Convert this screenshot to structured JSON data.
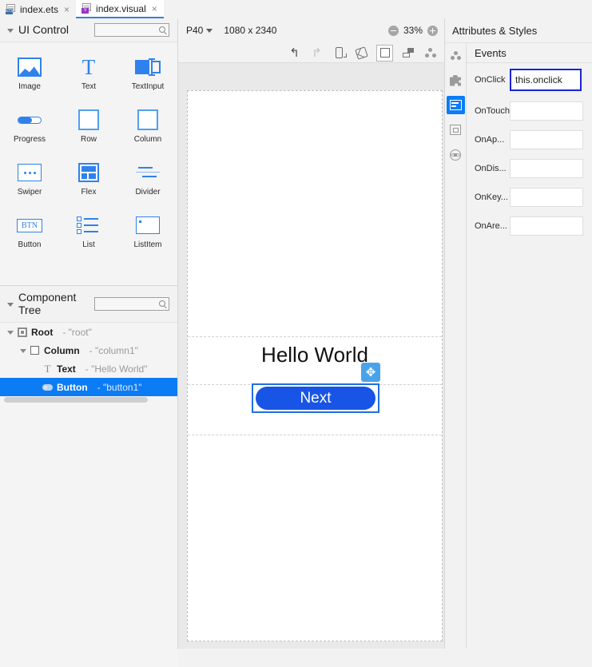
{
  "tabs": [
    {
      "label": "index.ets",
      "icon": "ets-file-icon",
      "badge": "ETS",
      "close": "×",
      "active": false
    },
    {
      "label": "index.visual",
      "icon": "visual-file-icon",
      "badge": "V",
      "close": "×",
      "active": true
    }
  ],
  "left_panel": {
    "ui_control": {
      "title": "UI Control",
      "search_placeholder": ""
    },
    "palette": [
      [
        {
          "label": "Image",
          "icon": "image-icon"
        },
        {
          "label": "Text",
          "icon": "text-icon"
        },
        {
          "label": "TextInput",
          "icon": "textinput-icon"
        }
      ],
      [
        {
          "label": "Progress",
          "icon": "progress-icon"
        },
        {
          "label": "Row",
          "icon": "row-icon"
        },
        {
          "label": "Column",
          "icon": "column-icon"
        }
      ],
      [
        {
          "label": "Swiper",
          "icon": "swiper-icon"
        },
        {
          "label": "Flex",
          "icon": "flex-icon"
        },
        {
          "label": "Divider",
          "icon": "divider-icon"
        }
      ],
      [
        {
          "label": "Button",
          "icon": "button-icon",
          "glyph_text": "BTN"
        },
        {
          "label": "List",
          "icon": "list-icon"
        },
        {
          "label": "ListItem",
          "icon": "listitem-icon"
        }
      ]
    ],
    "component_tree": {
      "title": "Component Tree",
      "search_placeholder": "",
      "rows": [
        {
          "label": "Root",
          "note": "- \"root\"",
          "icon": "root-icon",
          "depth": 0,
          "expanded": true,
          "selected": false
        },
        {
          "label": "Column",
          "note": "- \"column1\"",
          "icon": "column-node-icon",
          "depth": 1,
          "expanded": true,
          "selected": false
        },
        {
          "label": "Text",
          "note": "- \"Hello World\"",
          "icon": "text-node-icon",
          "depth": 2,
          "expanded": false,
          "selected": false
        },
        {
          "label": "Button",
          "note": "- \"button1\"",
          "icon": "button-node-icon",
          "depth": 2,
          "expanded": false,
          "selected": true
        }
      ]
    }
  },
  "toolbar": {
    "device": "P40",
    "resolution": "1080 x 2340",
    "zoom": "33%",
    "zoom_out_label": "−",
    "zoom_in_label": "+",
    "actions": [
      {
        "name": "undo-button",
        "icon": "undo-arrow-icon",
        "enabled": true
      },
      {
        "name": "redo-button",
        "icon": "redo-arrow-icon",
        "enabled": false
      },
      {
        "name": "device-orientation-button",
        "icon": "phone-rotate-icon",
        "enabled": true
      },
      {
        "name": "rotate-button",
        "icon": "rotate-icon",
        "enabled": true
      },
      {
        "name": "frame-button",
        "icon": "square-frame-icon",
        "enabled": true,
        "active": true
      },
      {
        "name": "push-button",
        "icon": "push-layout-icon",
        "enabled": true
      },
      {
        "name": "tree-view-button",
        "icon": "node-tree-icon",
        "enabled": true
      }
    ]
  },
  "canvas": {
    "hello_text": "Hello World",
    "button_text": "Next",
    "drag_handle_icon": "✥",
    "accent_blue": "#1855e6",
    "selection_blue": "#1f6fe0"
  },
  "right_panel": {
    "title": "Attributes & Styles",
    "vstrip": [
      {
        "name": "components-icon",
        "active": false
      },
      {
        "name": "puzzle-icon",
        "active": false
      },
      {
        "name": "events-card-icon",
        "active": true
      },
      {
        "name": "frame-icon",
        "active": false
      },
      {
        "name": "atom-icon",
        "active": false
      }
    ],
    "events": {
      "header": "Events",
      "rows": [
        {
          "label": "OnClick",
          "value": "this.onclick",
          "focused": true
        },
        {
          "label": "OnTouch",
          "value": "",
          "focused": false
        },
        {
          "label": "OnAp...",
          "value": "",
          "focused": false
        },
        {
          "label": "OnDis...",
          "value": "",
          "focused": false
        },
        {
          "label": "OnKey...",
          "value": "",
          "focused": false
        },
        {
          "label": "OnAre...",
          "value": "",
          "focused": false
        }
      ]
    }
  }
}
